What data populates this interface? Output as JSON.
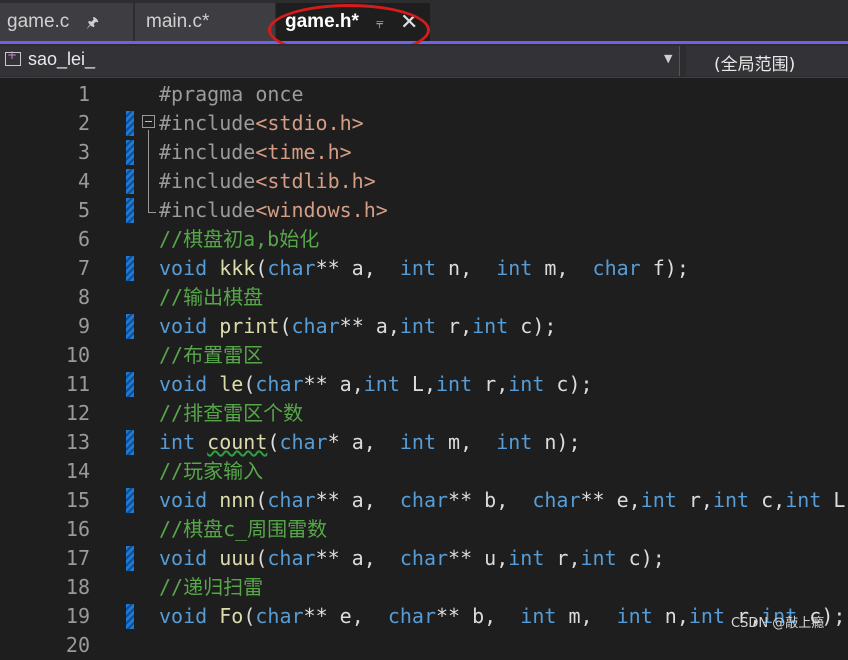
{
  "tabs": [
    {
      "label": "game.c",
      "pinned": true,
      "active": false
    },
    {
      "label": "main.c*",
      "active": false
    },
    {
      "label": "game.h*",
      "active": true
    }
  ],
  "navbar": {
    "project": "sao_lei_",
    "scope": "(全局范围)"
  },
  "colors": {
    "accent": "#7160e8",
    "annotation_circle": "#d41c1c",
    "keyword": "#569cd6",
    "comment": "#57a64a",
    "string": "#d69d85",
    "function": "#dcdcaa"
  },
  "editor": {
    "lines": [
      {
        "num": "1",
        "parts": [
          [
            "pp",
            "#pragma once"
          ]
        ]
      },
      {
        "num": "2",
        "parts": [
          [
            "pp",
            "#include"
          ],
          [
            "str",
            "<stdio.h>"
          ]
        ]
      },
      {
        "num": "3",
        "parts": [
          [
            "pp",
            "#include"
          ],
          [
            "str",
            "<time.h>"
          ]
        ]
      },
      {
        "num": "4",
        "parts": [
          [
            "pp",
            "#include"
          ],
          [
            "str",
            "<stdlib.h>"
          ]
        ]
      },
      {
        "num": "5",
        "parts": [
          [
            "pp",
            "#include"
          ],
          [
            "str",
            "<windows.h>"
          ]
        ]
      },
      {
        "num": "6",
        "parts": [
          [
            "cm",
            "//棋盘初a,b始化"
          ]
        ]
      },
      {
        "num": "7",
        "parts": [
          [
            "kw",
            "void"
          ],
          [
            "txt",
            " "
          ],
          [
            "fn",
            "kkk"
          ],
          [
            "txt",
            "("
          ],
          [
            "kw",
            "char"
          ],
          [
            "txt",
            "** a,  "
          ],
          [
            "kw",
            "int"
          ],
          [
            "txt",
            " n,  "
          ],
          [
            "kw",
            "int"
          ],
          [
            "txt",
            " m,  "
          ],
          [
            "kw",
            "char"
          ],
          [
            "txt",
            " f);"
          ]
        ]
      },
      {
        "num": "8",
        "parts": [
          [
            "cm",
            "//输出棋盘"
          ]
        ]
      },
      {
        "num": "9",
        "parts": [
          [
            "kw",
            "void"
          ],
          [
            "txt",
            " "
          ],
          [
            "fn",
            "print"
          ],
          [
            "txt",
            "("
          ],
          [
            "kw",
            "char"
          ],
          [
            "txt",
            "** a,"
          ],
          [
            "kw",
            "int"
          ],
          [
            "txt",
            " r,"
          ],
          [
            "kw",
            "int"
          ],
          [
            "txt",
            " c);"
          ]
        ]
      },
      {
        "num": "10",
        "parts": [
          [
            "cm",
            "//布置雷区"
          ]
        ]
      },
      {
        "num": "11",
        "parts": [
          [
            "kw",
            "void"
          ],
          [
            "txt",
            " "
          ],
          [
            "fn",
            "le"
          ],
          [
            "txt",
            "("
          ],
          [
            "kw",
            "char"
          ],
          [
            "txt",
            "** a,"
          ],
          [
            "kw",
            "int"
          ],
          [
            "txt",
            " L,"
          ],
          [
            "kw",
            "int"
          ],
          [
            "txt",
            " r,"
          ],
          [
            "kw",
            "int"
          ],
          [
            "txt",
            " c);"
          ]
        ]
      },
      {
        "num": "12",
        "parts": [
          [
            "cm",
            "//排查雷区个数"
          ]
        ]
      },
      {
        "num": "13",
        "parts": [
          [
            "kw",
            "int"
          ],
          [
            "txt",
            " "
          ],
          [
            "fnsq",
            "count"
          ],
          [
            "txt",
            "("
          ],
          [
            "kw",
            "char"
          ],
          [
            "txt",
            "* a,  "
          ],
          [
            "kw",
            "int"
          ],
          [
            "txt",
            " m,  "
          ],
          [
            "kw",
            "int"
          ],
          [
            "txt",
            " n);"
          ]
        ]
      },
      {
        "num": "14",
        "parts": [
          [
            "cm",
            "//玩家输入"
          ]
        ]
      },
      {
        "num": "15",
        "parts": [
          [
            "kw",
            "void"
          ],
          [
            "txt",
            " "
          ],
          [
            "fn",
            "nnn"
          ],
          [
            "txt",
            "("
          ],
          [
            "kw",
            "char"
          ],
          [
            "txt",
            "** a,  "
          ],
          [
            "kw",
            "char"
          ],
          [
            "txt",
            "** b,  "
          ],
          [
            "kw",
            "char"
          ],
          [
            "txt",
            "** e,"
          ],
          [
            "kw",
            "int"
          ],
          [
            "txt",
            " r,"
          ],
          [
            "kw",
            "int"
          ],
          [
            "txt",
            " c,"
          ],
          [
            "kw",
            "int"
          ],
          [
            "txt",
            " L);"
          ]
        ]
      },
      {
        "num": "16",
        "parts": [
          [
            "cm",
            "//棋盘c_周围雷数"
          ]
        ]
      },
      {
        "num": "17",
        "parts": [
          [
            "kw",
            "void"
          ],
          [
            "txt",
            " "
          ],
          [
            "fn",
            "uuu"
          ],
          [
            "txt",
            "("
          ],
          [
            "kw",
            "char"
          ],
          [
            "txt",
            "** a,  "
          ],
          [
            "kw",
            "char"
          ],
          [
            "txt",
            "** u,"
          ],
          [
            "kw",
            "int"
          ],
          [
            "txt",
            " r,"
          ],
          [
            "kw",
            "int"
          ],
          [
            "txt",
            " c);"
          ]
        ]
      },
      {
        "num": "18",
        "parts": [
          [
            "cm",
            "//递归扫雷"
          ]
        ]
      },
      {
        "num": "19",
        "parts": [
          [
            "kw",
            "void"
          ],
          [
            "txt",
            " "
          ],
          [
            "fn",
            "Fo"
          ],
          [
            "txt",
            "("
          ],
          [
            "kw",
            "char"
          ],
          [
            "txt",
            "** e,  "
          ],
          [
            "kw",
            "char"
          ],
          [
            "txt",
            "** b,  "
          ],
          [
            "kw",
            "int"
          ],
          [
            "txt",
            " m,  "
          ],
          [
            "kw",
            "int"
          ],
          [
            "txt",
            " n,"
          ],
          [
            "kw",
            "int"
          ],
          [
            "txt",
            " r,"
          ],
          [
            "kw",
            "int"
          ],
          [
            "txt",
            " c);"
          ]
        ]
      },
      {
        "num": "20",
        "parts": []
      }
    ],
    "change_marker_lines": [
      "2",
      "3",
      "4",
      "5",
      "7",
      "9",
      "11",
      "13",
      "15",
      "17",
      "19"
    ]
  },
  "watermark": "CSDN @敲上瘾"
}
